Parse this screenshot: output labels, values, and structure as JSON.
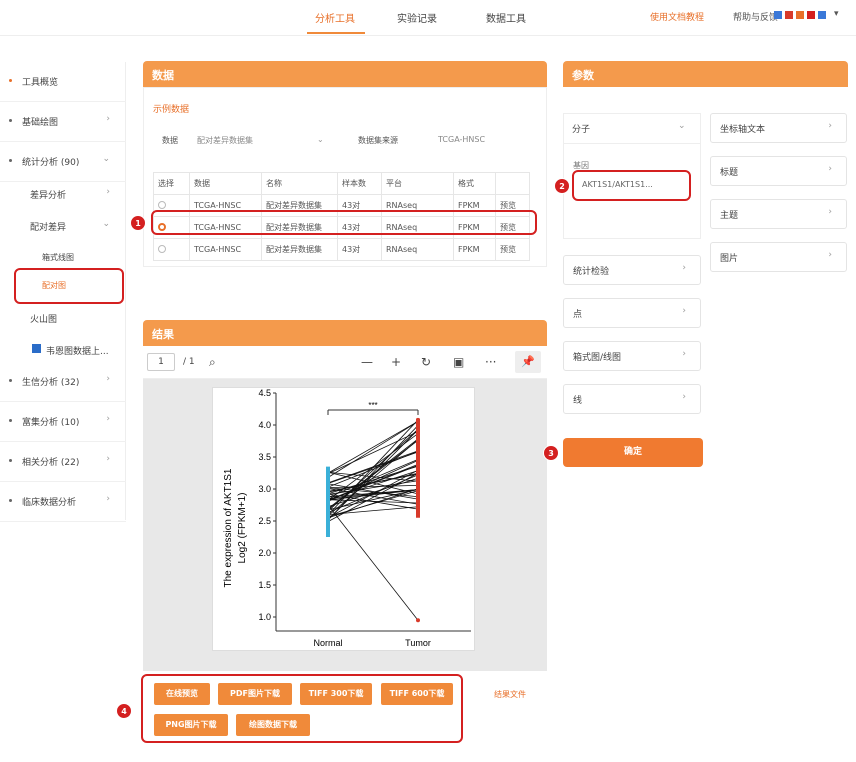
{
  "topnav": {
    "items": [
      "分析工具",
      "实验记录",
      "数据工具"
    ],
    "link": "使用文档教程",
    "user": "帮助与反馈"
  },
  "sidebar": {
    "items": [
      {
        "label": "工具概览"
      },
      {
        "label": "基础绘图"
      },
      {
        "label": "统计分析 (90)"
      }
    ],
    "sub1": "差异分析",
    "sub2": "配对差异",
    "sub3": "箱式线图",
    "sub4": "配对图",
    "sub5": "火山图",
    "sub6": "韦恩图数据上...",
    "items2": [
      {
        "label": "生信分析 (32)"
      },
      {
        "label": "富集分析 (10)"
      },
      {
        "label": "相关分析 (22)"
      },
      {
        "label": "临床数据分析"
      }
    ]
  },
  "data_panel": {
    "title": "数据",
    "link": "示例数据",
    "field1_label": "数据",
    "field1_value": "配对差异数据集",
    "field2_label": "数据集来源",
    "field2_value": "TCGA-HNSC",
    "headers": [
      "选择",
      "数据",
      "名称",
      "样本数",
      "平台",
      "格式",
      ""
    ],
    "rows": [
      [
        "",
        "TCGA-HNSC",
        "配对差异数据集",
        "43对",
        "RNAseq",
        "FPKM",
        "预览"
      ],
      [
        "",
        "TCGA-HNSC",
        "配对差异数据集",
        "43对",
        "RNAseq",
        "FPKM",
        "预览"
      ],
      [
        "",
        "TCGA-HNSC",
        "配对差异数据集",
        "43对",
        "RNAseq",
        "FPKM",
        "预览"
      ]
    ]
  },
  "result_panel": {
    "title": "结果",
    "page": "1",
    "total": "/ 1",
    "sig": "***",
    "ylabel": "The expression of AKT1S1",
    "ylabel2": "Log2 (FPKM+1)",
    "yticks": [
      "4.5",
      "4.0",
      "3.5",
      "3.0",
      "2.5",
      "2.0",
      "1.5",
      "1.0"
    ],
    "xticks": [
      "Normal",
      "Tumor"
    ],
    "buttons_row1": [
      "在线预览",
      "PDF图片下载",
      "TIFF 300下载",
      "TIFF 600下载"
    ],
    "buttons_row2": [
      "PNG图片下载",
      "绘图数据下载"
    ],
    "side_link": "结果文件"
  },
  "params_panel": {
    "title": "参数",
    "select1": "分子",
    "gene_label": "基因",
    "gene_value": "AKT1S1/AKT1S1...",
    "rows": [
      "统计检验",
      "点",
      "箱式图/线图",
      "线"
    ],
    "col": [
      "坐标轴文本",
      "标题",
      "主题",
      "图片"
    ],
    "submit": "确定"
  },
  "badges": [
    "1",
    "2",
    "3",
    "4"
  ],
  "colors": {
    "accent": "#f08a3a",
    "normal": "#3ab0d8",
    "tumor": "#d83a2a",
    "annot": "#d42020"
  }
}
